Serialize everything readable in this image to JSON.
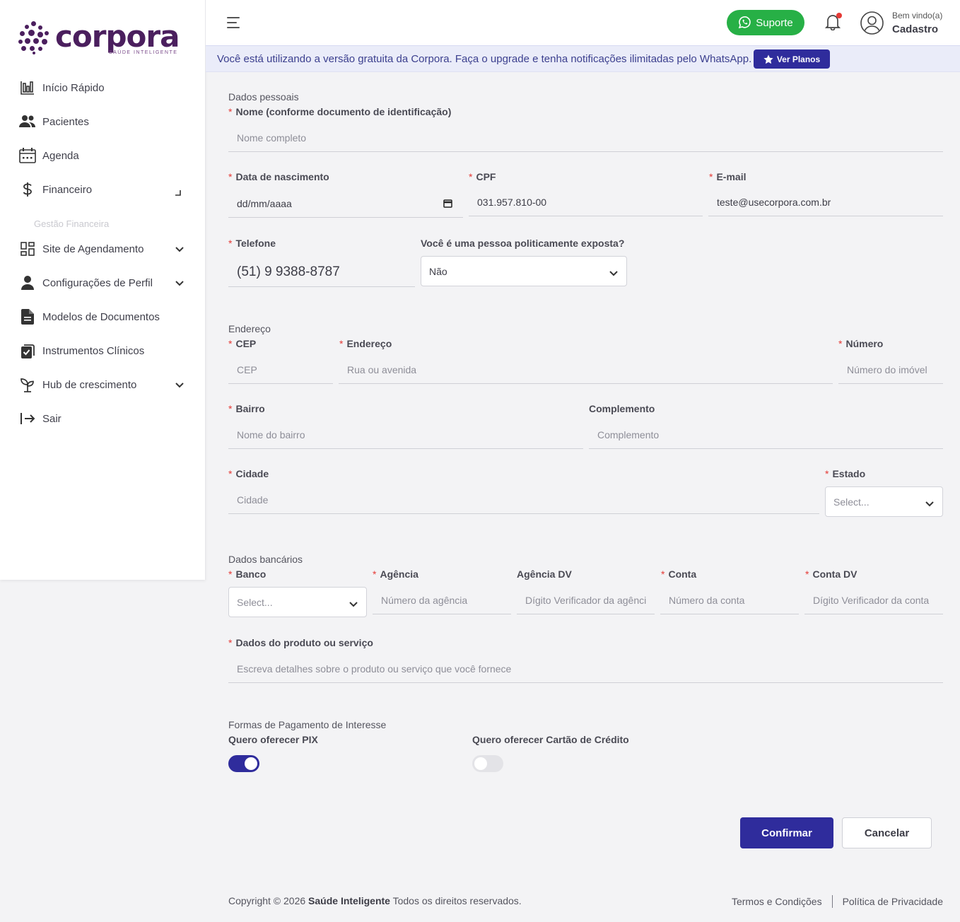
{
  "brand": {
    "name": "corpora",
    "tagline": "SAÚDE INTELIGENTE"
  },
  "sidebar": {
    "items": [
      {
        "label": "Início Rápido",
        "icon": "bar-chart-icon"
      },
      {
        "label": "Pacientes",
        "icon": "users-icon"
      },
      {
        "label": "Agenda",
        "icon": "calendar-icon"
      },
      {
        "label": "Financeiro",
        "icon": "dollar-icon"
      },
      {
        "label": "Site de Agendamento",
        "icon": "grid-icon"
      },
      {
        "label": "Configurações de Perfil",
        "icon": "user-icon"
      },
      {
        "label": "Modelos de Documentos",
        "icon": "document-icon"
      },
      {
        "label": "Instrumentos Clínicos",
        "icon": "clipboard-icon"
      },
      {
        "label": "Hub de crescimento",
        "icon": "sprout-icon"
      },
      {
        "label": "Sair",
        "icon": "logout-icon"
      }
    ],
    "financeiro_sub": "Gestão Financeira"
  },
  "header": {
    "support_label": "Suporte",
    "welcome": "Bem vindo(a)",
    "user_name": "Cadastro"
  },
  "banner": {
    "text": "Você está utilizando a versão gratuita da Corpora. Faça o upgrade e tenha notificações ilimitadas pelo WhatsApp.",
    "button": "Ver Planos"
  },
  "personal": {
    "section": "Dados pessoais",
    "name_label": "Nome (conforme documento de identificação)",
    "name_placeholder": "Nome completo",
    "birth_label": "Data de nascimento",
    "birth_placeholder": "dd/mm/aaaa",
    "cpf_label": "CPF",
    "cpf_value": "031.957.810-00",
    "email_label": "E-mail",
    "email_value": "teste@usecorpora.com.br",
    "phone_label": "Telefone",
    "phone_value": "(51) 9 9388-8787",
    "pep_label": "Você é uma pessoa politicamente exposta?",
    "pep_value": "Não"
  },
  "address": {
    "section": "Endereço",
    "cep_label": "CEP",
    "cep_placeholder": "CEP",
    "street_label": "Endereço",
    "street_placeholder": "Rua ou avenida",
    "number_label": "Número",
    "number_placeholder": "Número do imóvel",
    "district_label": "Bairro",
    "district_placeholder": "Nome do bairro",
    "complement_label": "Complemento",
    "complement_placeholder": "Complemento",
    "city_label": "Cidade",
    "city_placeholder": "Cidade",
    "state_label": "Estado",
    "state_value": "Select..."
  },
  "bank": {
    "section": "Dados bancários",
    "bank_label": "Banco",
    "bank_value": "Select...",
    "agency_label": "Agência",
    "agency_placeholder": "Número da agência",
    "agency_dv_label": "Agência DV",
    "agency_dv_placeholder": "Dígito Verificador da agência",
    "account_label": "Conta",
    "account_placeholder": "Número da conta",
    "account_dv_label": "Conta DV",
    "account_dv_placeholder": "Dígito Verificador da conta",
    "product_label": "Dados do produto ou serviço",
    "product_placeholder": "Escreva detalhes sobre o produto ou serviço que você fornece"
  },
  "payment": {
    "section": "Formas de Pagamento de Interesse",
    "pix_label": "Quero oferecer PIX",
    "pix_on": true,
    "card_label": "Quero oferecer Cartão de Crédito",
    "card_on": false
  },
  "actions": {
    "confirm": "Confirmar",
    "cancel": "Cancelar"
  },
  "footer": {
    "copyright_prefix": "Copyright © 2026",
    "company": "Saúde Inteligente",
    "copyright_suffix": "Todos os direitos reservados.",
    "terms": "Termos e Condições",
    "privacy": "Política de Privacidade"
  },
  "colors": {
    "primary": "#2f2c9c",
    "brand": "#4b1f5e",
    "success": "#27b046",
    "required": "#e53935"
  }
}
